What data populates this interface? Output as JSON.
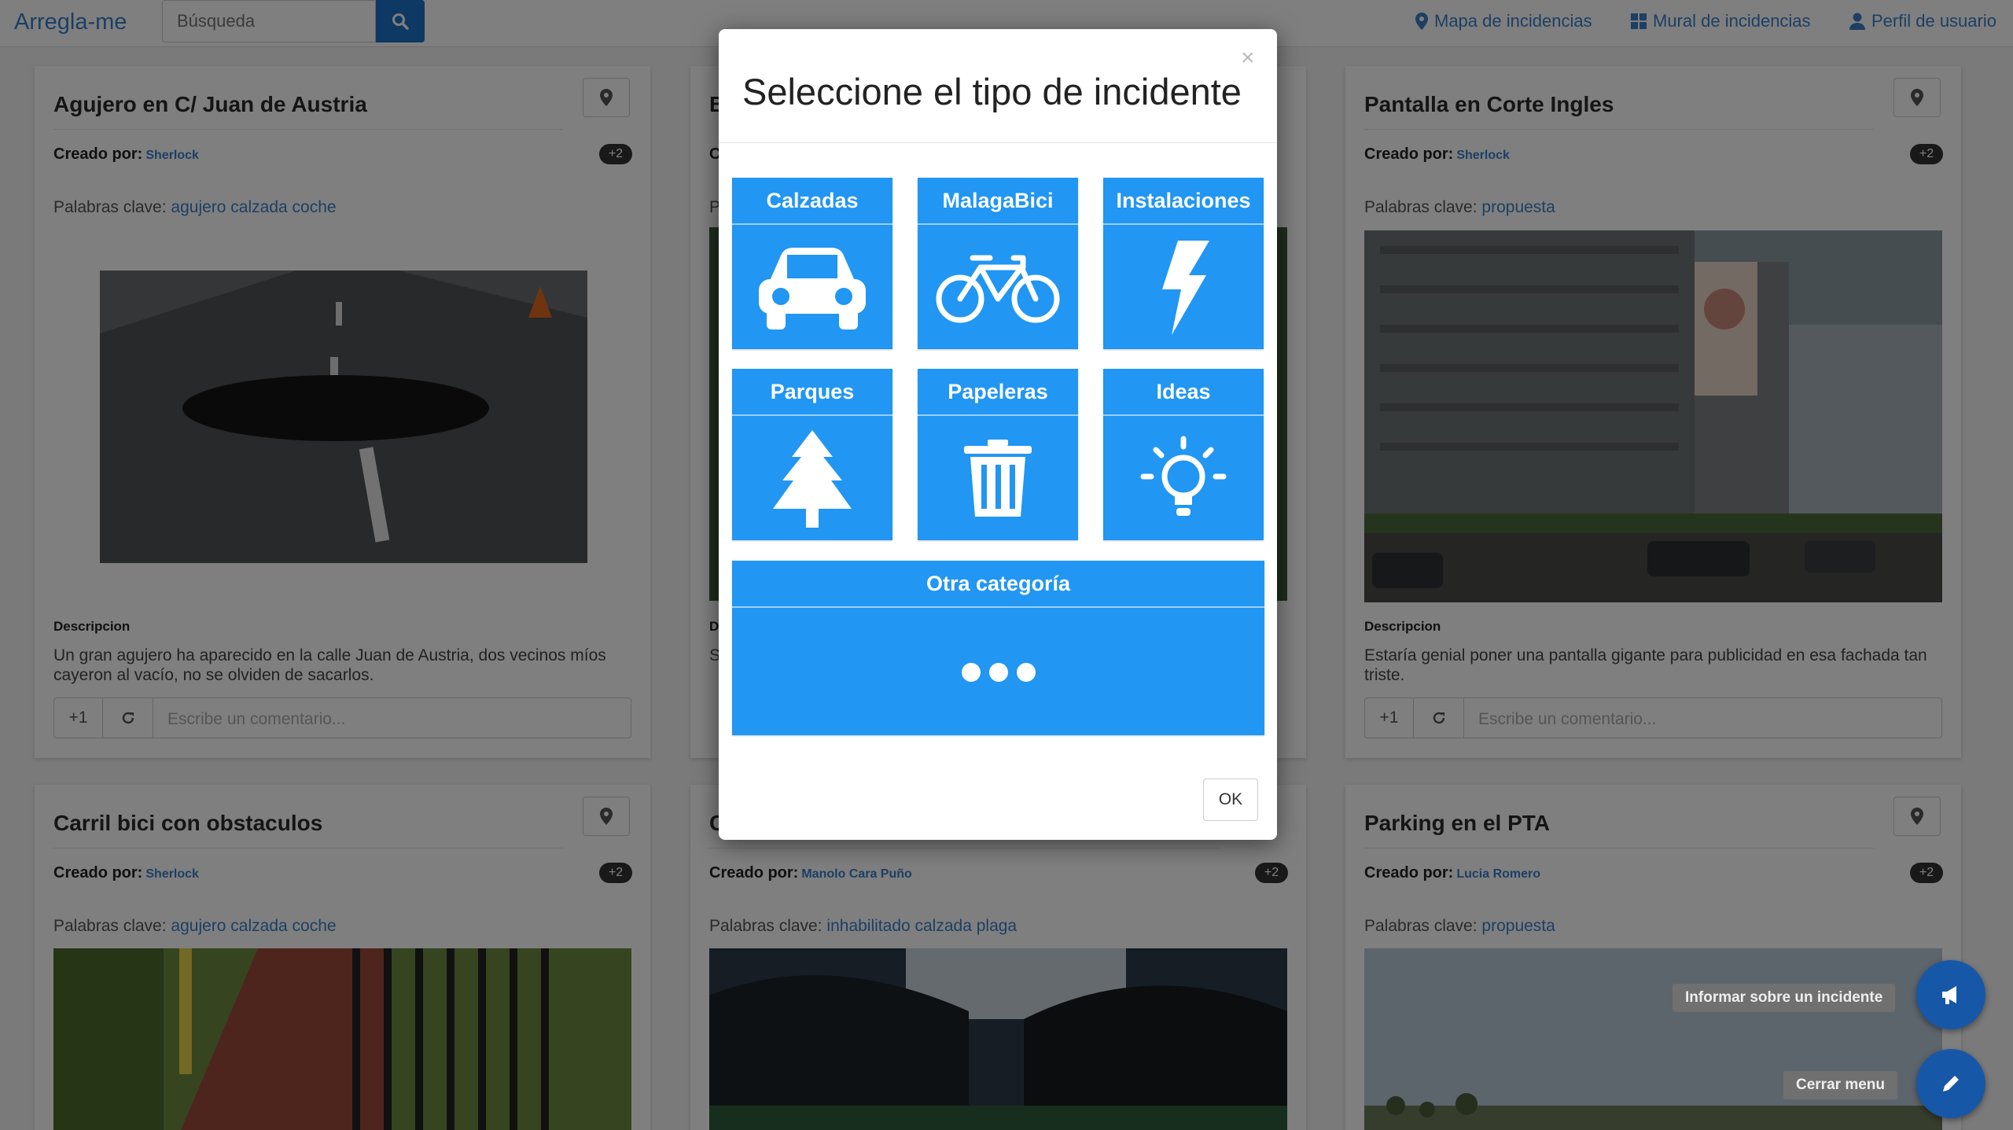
{
  "navbar": {
    "brand": "Arregla-me",
    "search_placeholder": "Búsqueda",
    "links": [
      "Mapa de incidencias",
      "Mural de incidencias",
      "Perfil de usuario"
    ]
  },
  "labels": {
    "creado_por": "Creado por:",
    "palabras_clave": "Palabras clave:",
    "descripcion": "Descripcion",
    "comment_placeholder": "Escribe un comentario...",
    "plus_one": "+1"
  },
  "cards": [
    {
      "title": "Agujero en C/ Juan de Austria",
      "author": "Sherlock",
      "votes": "+2",
      "keywords": "agujero calzada coche",
      "description": "Un gran agujero ha aparecido en la calle Juan de Austria, dos vecinos míos cayeron al vacío, no se olviden de sacarlos."
    },
    {
      "title": "B",
      "author": "",
      "votes": "",
      "keywords": "",
      "description": "S"
    },
    {
      "title": "Pantalla en Corte Ingles",
      "author": "Sherlock",
      "votes": "+2",
      "keywords": "propuesta",
      "description": "Estaría genial poner una pantalla gigante para publicidad en esa fachada tan triste."
    },
    {
      "title": "Carril bici con obstaculos",
      "author": "Sherlock",
      "votes": "+2",
      "keywords": "agujero calzada coche"
    },
    {
      "title": "C",
      "author": "Manolo Cara Puño",
      "votes": "+2",
      "keywords": "inhabilitado calzada plaga"
    },
    {
      "title": "Parking en el PTA",
      "author": "Lucia Romero",
      "votes": "+2",
      "keywords": "propuesta"
    }
  ],
  "fab": {
    "report_label": "Informar sobre un incidente",
    "close_label": "Cerrar menu"
  },
  "modal": {
    "close": "×",
    "title": "Seleccione el tipo de incidente",
    "categories": [
      {
        "label": "Calzadas",
        "icon": "car-icon"
      },
      {
        "label": "MalagaBici",
        "icon": "bicycle-icon"
      },
      {
        "label": "Instalaciones",
        "icon": "lightning-icon"
      },
      {
        "label": "Parques",
        "icon": "tree-icon"
      },
      {
        "label": "Papeleras",
        "icon": "trash-icon"
      },
      {
        "label": "Ideas",
        "icon": "lightbulb-icon"
      }
    ],
    "other": {
      "label": "Otra categoría",
      "icon": "ellipsis-icon"
    },
    "ok": "OK"
  },
  "colors": {
    "accent": "#2196f3",
    "link": "#3a7fc8",
    "nav_button": "#1d72c8",
    "fab": "#1757a8"
  }
}
